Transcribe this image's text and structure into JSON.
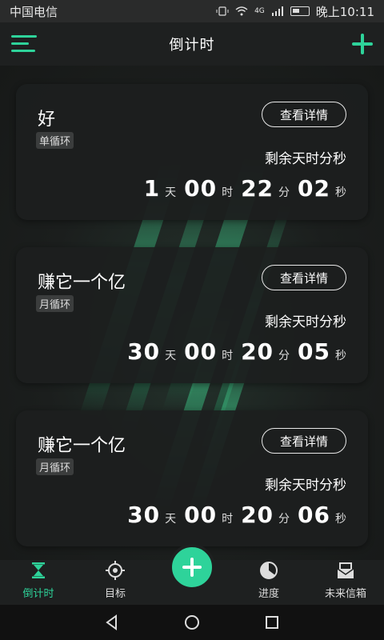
{
  "status_bar": {
    "carrier": "中国电信",
    "time": "晚上10:11",
    "network": "4G"
  },
  "header": {
    "title": "倒计时"
  },
  "cards": [
    {
      "title": "好",
      "tag": "单循环",
      "detail_label": "查看详情",
      "remain_label": "剩余天时分秒",
      "days": "1",
      "hours": "00",
      "minutes": "22",
      "seconds": "02"
    },
    {
      "title": "赚它一个亿",
      "tag": "月循环",
      "detail_label": "查看详情",
      "remain_label": "剩余天时分秒",
      "days": "30",
      "hours": "00",
      "minutes": "20",
      "seconds": "05"
    },
    {
      "title": "赚它一个亿",
      "tag": "月循环",
      "detail_label": "查看详情",
      "remain_label": "剩余天时分秒",
      "days": "30",
      "hours": "00",
      "minutes": "20",
      "seconds": "06"
    }
  ],
  "units": {
    "day": "天",
    "hour": "时",
    "minute": "分",
    "second": "秒"
  },
  "bottom_nav": {
    "items": [
      {
        "label": "倒计时",
        "icon": "hourglass-icon",
        "active": true
      },
      {
        "label": "目标",
        "icon": "target-icon",
        "active": false
      },
      {
        "label": "进度",
        "icon": "pie-progress-icon",
        "active": false
      },
      {
        "label": "未来信箱",
        "icon": "mailbox-icon",
        "active": false
      }
    ]
  },
  "colors": {
    "accent": "#2ed39a",
    "card_bg": "#1c1e1e",
    "background": "#1b1d1c"
  }
}
